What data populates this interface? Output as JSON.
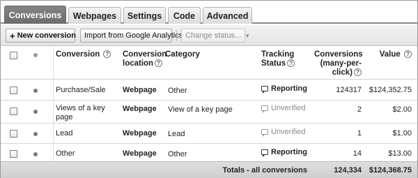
{
  "tabs": [
    {
      "label": "Conversions",
      "active": true
    },
    {
      "label": "Webpages",
      "active": false
    },
    {
      "label": "Settings",
      "active": false
    },
    {
      "label": "Code",
      "active": false
    },
    {
      "label": "Advanced",
      "active": false
    }
  ],
  "toolbar": {
    "new_conversion_label": "New conversion",
    "new_conversion_icon": "plus-icon",
    "import_label": "Import from Google Analytics",
    "change_status_label": "Change status...",
    "change_status_icon": "caret-down-icon"
  },
  "table": {
    "headers": {
      "conversion": "Conversion",
      "location_line1": "Conversion",
      "location_line2": "location",
      "category": "Category",
      "tracking_line1": "Tracking",
      "tracking_line2": "Status",
      "conversions_line1": "Conversions",
      "conversions_line2": "(many-per-",
      "conversions_line3": "click)",
      "value": "Value",
      "help_glyph": "?"
    },
    "rows": [
      {
        "name": "Purchase/Sale",
        "name_line2": "",
        "location": "Webpage",
        "category": "Other",
        "status": "Reporting",
        "status_icon": "speech-bubble-icon",
        "conversions": "124317",
        "value": "$124,352.75"
      },
      {
        "name": "Views of a key",
        "name_line2": "page",
        "location": "Webpage",
        "category": "View of a key page",
        "status": "Unverified",
        "status_icon": "speech-bubble-icon",
        "conversions": "2",
        "value": "$2.00"
      },
      {
        "name": "Lead",
        "name_line2": "",
        "location": "Webpage",
        "category": "Lead",
        "status": "Unverified",
        "status_icon": "speech-bubble-icon",
        "conversions": "1",
        "value": "$1.00"
      },
      {
        "name": "Other",
        "name_line2": "",
        "location": "Webpage",
        "category": "Other",
        "status": "Reporting",
        "status_icon": "speech-bubble-icon",
        "conversions": "14",
        "value": "$13.00"
      }
    ],
    "totals": {
      "label": "Totals - all conversions",
      "conversions": "124,334",
      "value": "$124,368.75"
    }
  },
  "colors": {
    "active_tab": "#7a7a7a",
    "status_reporting": "#222222",
    "status_unverified": "#888888"
  }
}
